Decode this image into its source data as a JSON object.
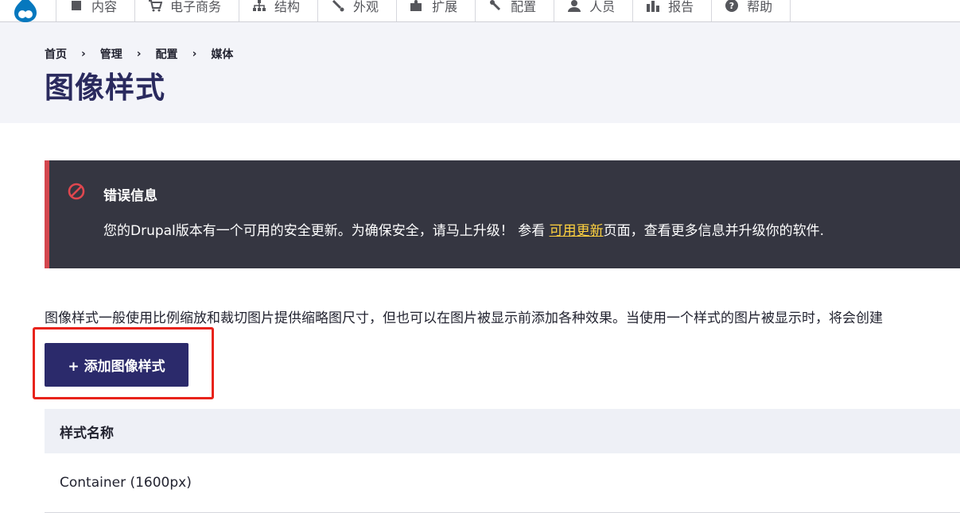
{
  "toolbar": {
    "items": [
      {
        "label": "内容",
        "icon": "content-icon"
      },
      {
        "label": "电子商务",
        "icon": "cart-icon"
      },
      {
        "label": "结构",
        "icon": "structure-icon"
      },
      {
        "label": "外观",
        "icon": "paintbrush-icon"
      },
      {
        "label": "扩展",
        "icon": "puzzle-icon"
      },
      {
        "label": "配置",
        "icon": "wrench-icon"
      },
      {
        "label": "人员",
        "icon": "people-icon"
      },
      {
        "label": "报告",
        "icon": "report-icon"
      },
      {
        "label": "帮助",
        "icon": "help-icon"
      }
    ]
  },
  "breadcrumb": [
    "首页",
    "管理",
    "配置",
    "媒体"
  ],
  "page_title": "图像样式",
  "error_message": {
    "title": "错误信息",
    "text_before": "您的Drupal版本有一个可用的安全更新。为确保安全，请马上升级！ 参看 ",
    "link": "可用更新",
    "text_after": "页面，查看更多信息并升级你的软件."
  },
  "description": "图像样式一般使用比例缩放和裁切图片提供缩略图尺寸，但也可以在图片被显示前添加各种效果。当使用一个样式的图片被显示时，将会创建",
  "add_button": "+ 添加图像样式",
  "table": {
    "header": "样式名称",
    "rows": [
      "Container (1600px)"
    ]
  },
  "colors": {
    "title": "#2a2a5e",
    "button": "#2b2a6b",
    "error_bg": "#353641",
    "error_border": "#d4474e",
    "link": "#ffd23f",
    "highlight": "#e8231b"
  }
}
